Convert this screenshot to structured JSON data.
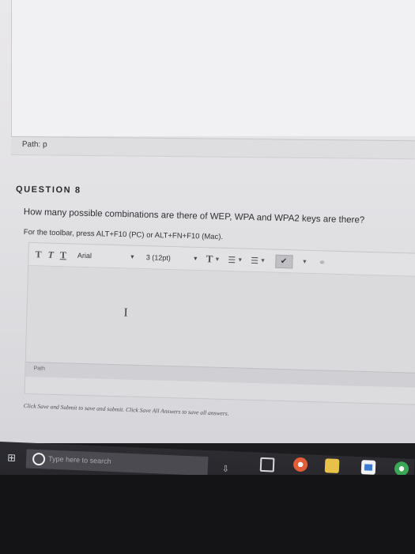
{
  "previous_question": {
    "path_label": "Path: p"
  },
  "question": {
    "title": "QUESTION 8",
    "text": "How many possible combinations are there of WEP, WPA and WPA2 keys are there?",
    "toolbar_hint": "For the toolbar, press ALT+F10 (PC) or ALT+FN+F10 (Mac)."
  },
  "editor": {
    "font_family": "Arial",
    "font_size": "3 (12pt)",
    "path_label": "Path"
  },
  "footer": {
    "submit_instructions": "Click Save and Submit to save and submit. Click Save All Answers to save all answers."
  },
  "taskbar": {
    "search_placeholder": "Type here to search"
  },
  "icons": {
    "bold": "T",
    "italic": "T",
    "underline": "T",
    "text_color": "T",
    "align": "☰",
    "list": "☰",
    "spellcheck": "✔",
    "link": "⚭",
    "cursor": "I",
    "start": "⊞",
    "mic": "⇩"
  }
}
